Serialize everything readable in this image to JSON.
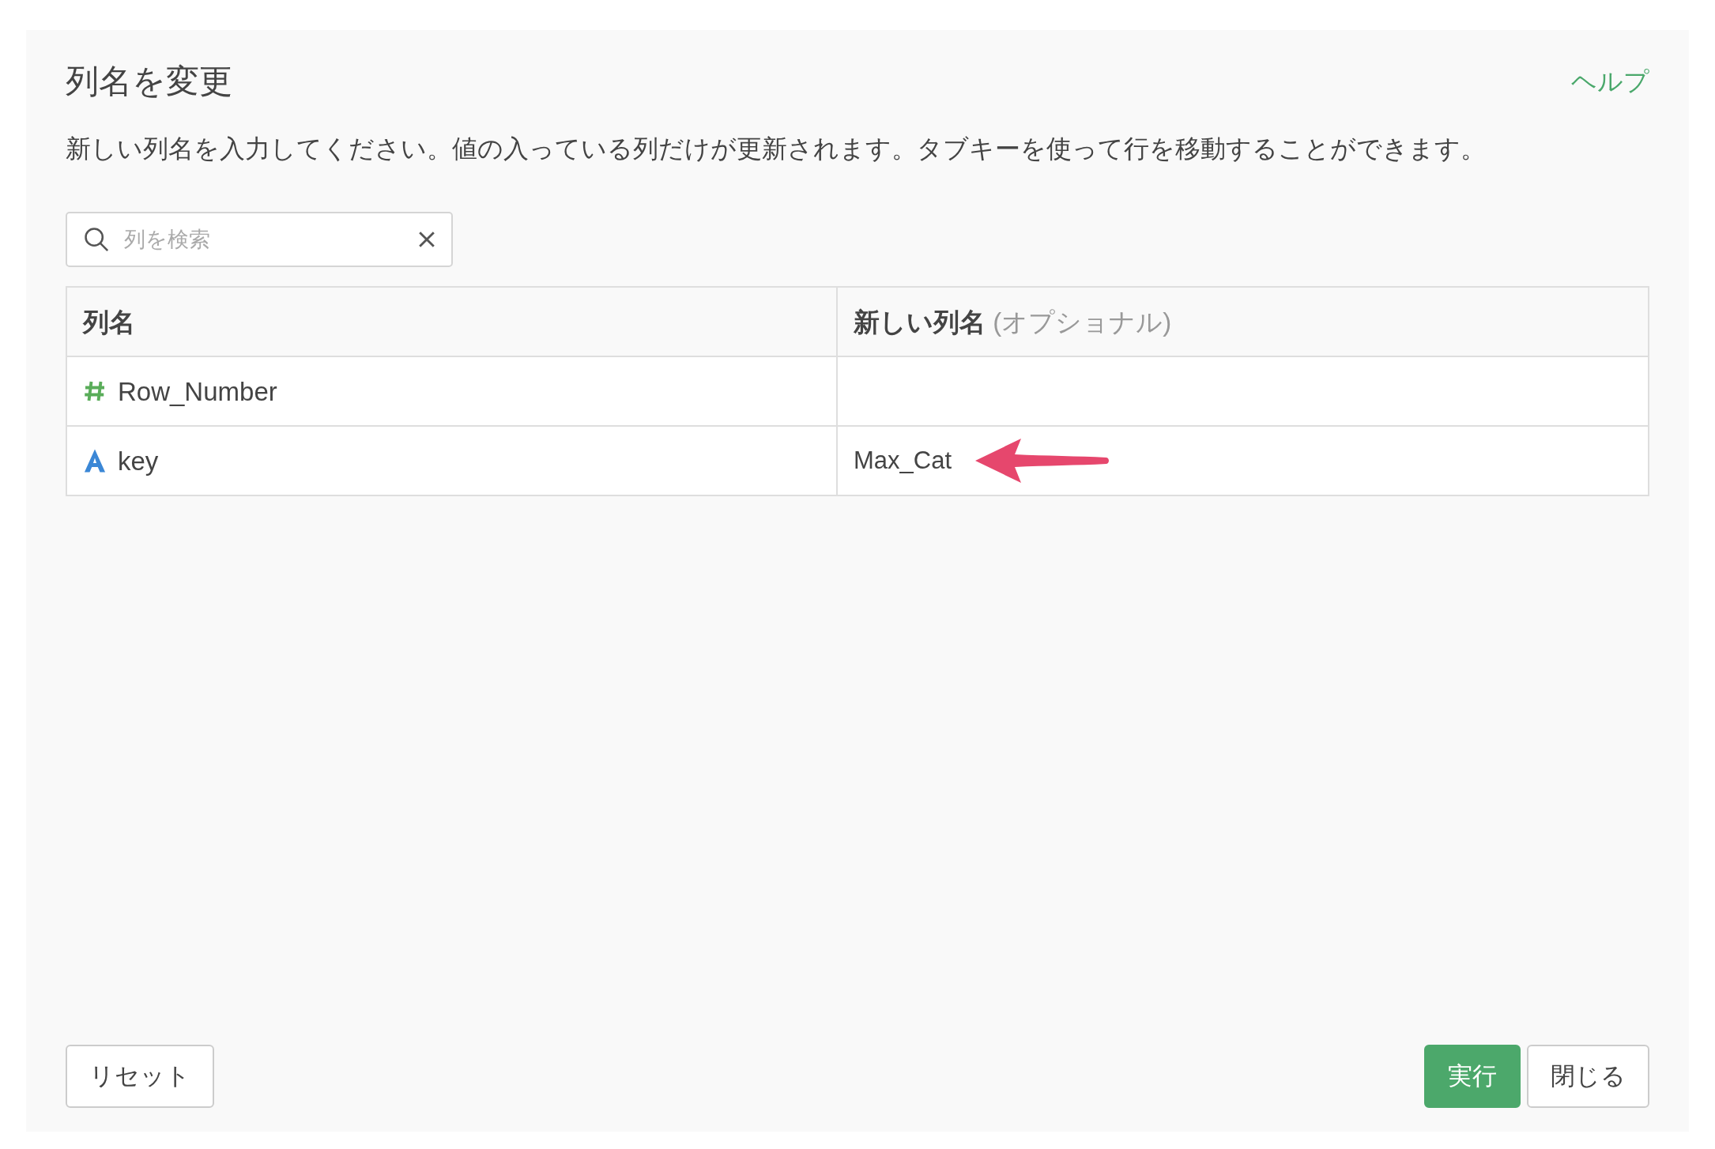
{
  "dialog": {
    "title": "列名を変更",
    "help_link": "ヘルプ",
    "description": "新しい列名を入力してください。値の入っている列だけが更新されます。タブキーを使って行を移動することができます。"
  },
  "search": {
    "placeholder": "列を検索"
  },
  "table": {
    "columns": [
      {
        "label": "列名"
      },
      {
        "label": "新しい列名",
        "note": "(オプショナル)"
      }
    ],
    "rows": [
      {
        "kind": "number",
        "name": "Row_Number",
        "arrow": false
      },
      {
        "kind": "text",
        "name": "key",
        "new_name": "Max_Cat",
        "arrow": true
      }
    ]
  },
  "buttons": {
    "left": [
      {
        "label": "リセット",
        "kind": "default"
      }
    ],
    "right": [
      {
        "label": "実行",
        "kind": "primary"
      },
      {
        "label": "閉じる",
        "kind": "default"
      }
    ]
  }
}
